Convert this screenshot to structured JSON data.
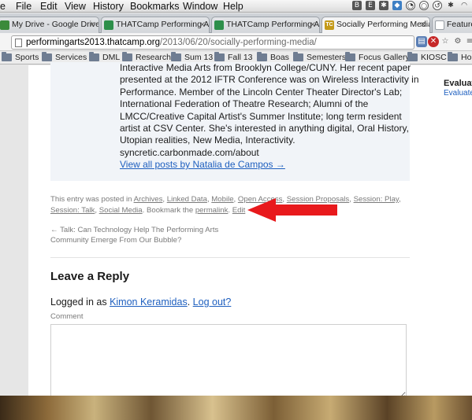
{
  "menubar": {
    "items": [
      "e",
      "File",
      "Edit",
      "View",
      "History",
      "Bookmarks",
      "Window",
      "Help"
    ]
  },
  "tabs": [
    {
      "label": "My Drive - Google Drive",
      "favicon_color": "#3b8a3a",
      "active": false
    },
    {
      "label": "THATCamp Performing Arts",
      "favicon_color": "#2d8f4a",
      "active": false
    },
    {
      "label": "THATCamp Performing Arts",
      "favicon_color": "#2d8f4a",
      "active": false
    },
    {
      "label": "Socially Performing Media",
      "favicon_color": "#c49a1a",
      "active": true
    },
    {
      "label": "Features |",
      "favicon_color": "#9aa0a6",
      "active": false
    }
  ],
  "address": {
    "domain": "performingarts2013.thatcamp.org",
    "path": "/2013/06/20/socially-performing-media/"
  },
  "bookmarks": [
    "Sports",
    "Services",
    "DML",
    "Research",
    "Sum 13",
    "Fall 13",
    "Boas",
    "Semesters",
    "Focus Gallery",
    "KIOSC",
    "Hom"
  ],
  "author_bio": {
    "lines": [
      "Interactive Media Arts from Brooklyn College/CUNY. Her recent paper",
      "presented at the 2012 IFTR Conference was on Wireless Interactivity in",
      "Performance. Member of the Lincoln Center Theater Director's Lab;",
      "International Federation of Theatre Research; Alumni of the",
      "LMCC/Creative Capital Artist's Summer Institute; long term resident",
      "artist at CSV Center. She's interested in anything digital, Oral History,",
      "Utopian realities, New Media, Interactivity.",
      "syncretic.carbonmade.com/about"
    ],
    "view_all_link": "View all posts by Natalia de Campos →"
  },
  "entry_meta": {
    "prefix": "This entry was posted in ",
    "categories": [
      "Archives",
      "Linked Data",
      "Mobile",
      "Open Access",
      "Session Proposals",
      "Session: Play",
      "Session: Talk",
      "Social Media"
    ],
    "bookmark_text": ". Bookmark the ",
    "permalink": "permalink",
    "edit": "Edit"
  },
  "post_nav": {
    "line1": "← Talk: Can Technology Help The Performing Arts",
    "line2": "Community Emerge From Our Bubble?"
  },
  "reply": {
    "title": "Leave a Reply",
    "logged_in_prefix": "Logged in as ",
    "user": "Kimon Keramidas",
    "logout": "Log out?",
    "comment_label": "Comment"
  },
  "sidebar": {
    "title": "Evaluat",
    "link": "Evaluate"
  },
  "colors": {
    "link": "#1e5fbf",
    "arrow": "#e8191c",
    "author_box": "#f1f4f8"
  }
}
